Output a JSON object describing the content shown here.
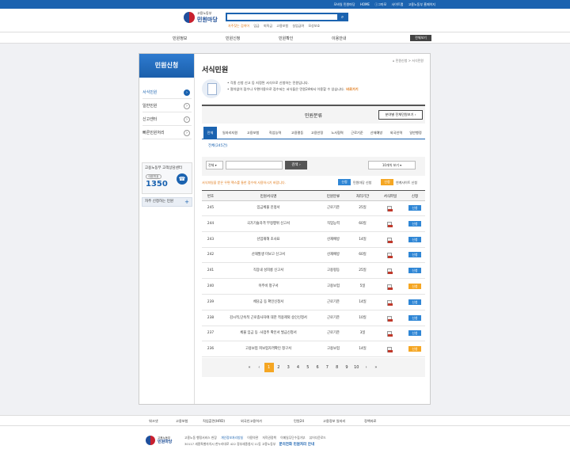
{
  "topbar": {
    "links": [
      "모바일 민원마당",
      "HOME",
      "ⓘ그마모",
      "사이트맵",
      "고용노동부 홈페이지"
    ]
  },
  "header": {
    "logo_top": "고용노동부",
    "logo_main": "민원마당",
    "search_placeholder": "",
    "search_icon": "search-icon",
    "keywords_title": "자주찾는 검색어",
    "keywords": [
      "임금",
      "퇴직금",
      "고용보험",
      "실업급여",
      "모성보호"
    ]
  },
  "gnb": {
    "items": [
      "민원정보",
      "민원신청",
      "민원확인",
      "이용안내"
    ],
    "fullmenu": "전체보기"
  },
  "lnb": {
    "title": "민원신청",
    "items": [
      {
        "label": "서식민원",
        "active": true
      },
      {
        "label": "일반민원",
        "active": false
      },
      {
        "label": "신고센터",
        "active": false
      },
      {
        "label": "빠른민원처리",
        "active": false
      }
    ],
    "callcenter": {
      "title": "고용노동부 고객상담센터",
      "badge": "대표번호",
      "number": "1350"
    },
    "frequent": "자주 신청하는 민원"
  },
  "content": {
    "path": "민원신청 > 서식민원",
    "title": "서식민원",
    "intro_lines": [
      "• 각종 신청 신고 등 지정된 서식으로 신청하는 민원입니다.",
      "• 절차없이 접수나 우편이용으로 접수되는 서식들은 민원24에서 이용할 수 있습니다."
    ],
    "intro_go": "바로가기",
    "section_title": "민원분류",
    "section_all": "분야별 전체민원보기",
    "tabs": [
      "전체",
      "일자리지원",
      "고용보험",
      "직업능력",
      "고용평등",
      "고용안정",
      "노사협력",
      "근로기준",
      "산재예방",
      "외국인력",
      "일반행정"
    ],
    "subtab": "전체(245건)",
    "filter_select": "전체",
    "search_btn": "검색",
    "page_size": "10개씩 보기",
    "note": "서식파일을 받은 우편 팩스를 통한 접수에 사용하시기 바랍니다.",
    "legend_b1": "신청",
    "legend_l1": "민원마당 신청",
    "legend_b2": "신청",
    "legend_l2": "연계사이트 신청",
    "table_headers": [
      "번호",
      "민원서식명",
      "민원분류",
      "처리기간",
      "서식파일",
      "신청"
    ],
    "rows": [
      {
        "no": "245",
        "name": "임금체불 진정서",
        "cat": "근로기준",
        "days": "25일",
        "apply": "신청",
        "color": "blue"
      },
      {
        "no": "244",
        "name": "국가기술자격 부정행위 신고서",
        "cat": "직업능력",
        "days": "60일",
        "apply": "신청",
        "color": "blue"
      },
      {
        "no": "243",
        "name": "산업재해 조사표",
        "cat": "산재예방",
        "days": "14일",
        "apply": "신청",
        "color": "blue"
      },
      {
        "no": "242",
        "name": "산재발생 미보고 신고서",
        "cat": "산재예방",
        "days": "60일",
        "apply": "신청",
        "color": "blue"
      },
      {
        "no": "241",
        "name": "직장내 성희롱 신고서",
        "cat": "고용평등",
        "days": "25일",
        "apply": "신청",
        "color": "blue"
      },
      {
        "no": "240",
        "name": "이주비 청구서",
        "cat": "고용보험",
        "days": "5일",
        "apply": "신청",
        "color": "orange"
      },
      {
        "no": "239",
        "name": "체당금 등 확인신청서",
        "cat": "근로기준",
        "days": "14일",
        "apply": "신청",
        "color": "blue"
      },
      {
        "no": "238",
        "name": "감시적,단속적 근로종사자에 대한 적용제외 승인신청서",
        "cat": "근로기준",
        "days": "10일",
        "apply": "신청",
        "color": "blue"
      },
      {
        "no": "237",
        "name": "체불 임금 등 ·사업주 확인서 발급신청서",
        "cat": "근로기준",
        "days": "3일",
        "apply": "신청",
        "color": "blue"
      },
      {
        "no": "236",
        "name": "고용보험 피보험자격확인 청구서",
        "cat": "고용보험",
        "days": "14일",
        "apply": "신청",
        "color": "orange"
      }
    ],
    "pager": [
      "«",
      "‹",
      "1",
      "2",
      "3",
      "4",
      "5",
      "6",
      "7",
      "8",
      "9",
      "10",
      "›",
      "»"
    ]
  },
  "footer": {
    "links": [
      "워크넷",
      "고용보험",
      "직업훈련(HRD)",
      "외국인고용허가",
      "민원24",
      "고용정보 일자리",
      "정책자료"
    ],
    "logo_top": "고용노동부",
    "logo_main": "민원마당",
    "menu": [
      "고용노동 행정서비스 헌장",
      "개인정보처리방침",
      "이용약관",
      "저작권정책",
      "이메일무단수집거부",
      "뷰어다운로드"
    ],
    "address": "30117 세종특별자치시 한누리대로 422 정부세종청사 11동 고용노동부",
    "phone": "문의전화 민원처리 안내"
  }
}
